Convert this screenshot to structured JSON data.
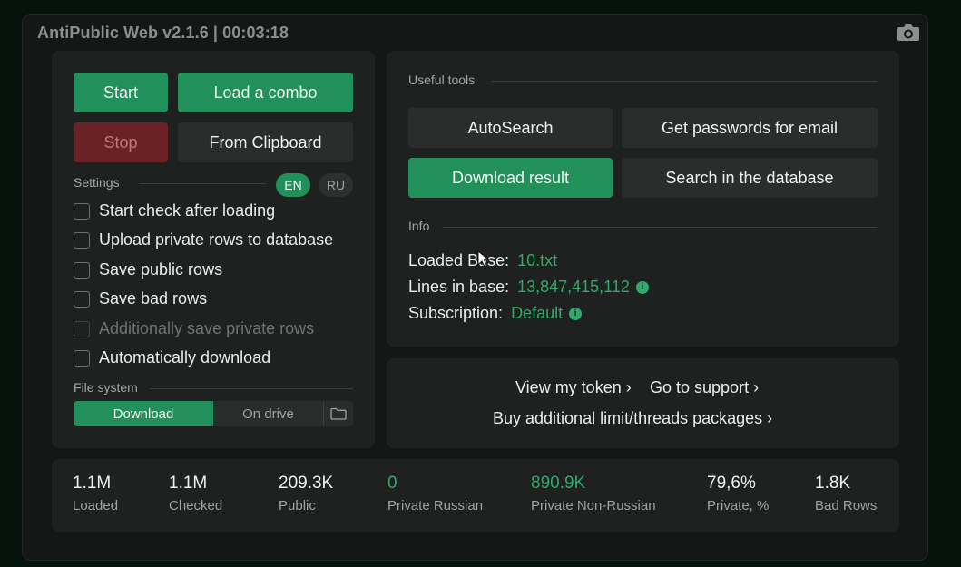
{
  "window": {
    "title": "AntiPublic Web v2.1.6 | 00:03:18",
    "icons": {
      "screenshot": "camera-icon"
    }
  },
  "controls": {
    "start": "Start",
    "load_combo": "Load a combo",
    "stop": "Stop",
    "from_clipboard": "From Clipboard"
  },
  "settings": {
    "label": "Settings",
    "languages": [
      {
        "label": "EN",
        "selected": true
      },
      {
        "label": "RU",
        "selected": false
      }
    ],
    "options": [
      {
        "label": "Start check after loading",
        "checked": false,
        "disabled": false
      },
      {
        "label": "Upload private rows to database",
        "checked": false,
        "disabled": false
      },
      {
        "label": "Save public rows",
        "checked": false,
        "disabled": false
      },
      {
        "label": "Save bad rows",
        "checked": false,
        "disabled": false
      },
      {
        "label": "Additionally save private rows",
        "checked": false,
        "disabled": true
      },
      {
        "label": "Automatically download",
        "checked": false,
        "disabled": false
      }
    ]
  },
  "file_system": {
    "label": "File system",
    "options": [
      "Download",
      "On drive"
    ],
    "selected": "Download",
    "folder_icon": "folder-icon"
  },
  "tools": {
    "label": "Useful tools",
    "buttons": {
      "autosearch": "AutoSearch",
      "get_passwords": "Get passwords for email",
      "download_result": "Download result",
      "search_database": "Search in the database"
    }
  },
  "info": {
    "label": "Info",
    "loaded_base": {
      "key": "Loaded Base:",
      "value": "10.txt"
    },
    "lines_in_base": {
      "key": "Lines in base:",
      "value": "13,847,415,112"
    },
    "subscription": {
      "key": "Subscription:",
      "value": "Default"
    },
    "icon": "info-icon"
  },
  "links": {
    "view_token": "View my token ›",
    "support": "Go to support ›",
    "buy_packages": "Buy additional limit/threads packages ›"
  },
  "stats": [
    {
      "value": "1.1M",
      "label": "Loaded",
      "accent": false
    },
    {
      "value": "1.1M",
      "label": "Checked",
      "accent": false
    },
    {
      "value": "209.3K",
      "label": "Public",
      "accent": false
    },
    {
      "value": "0",
      "label": "Private Russian",
      "accent": true
    },
    {
      "value": "890.9K",
      "label": "Private Non-Russian",
      "accent": true
    },
    {
      "value": "79,6%",
      "label": "Private, %",
      "accent": false
    },
    {
      "value": "1.8K",
      "label": "Bad Rows",
      "accent": false
    }
  ],
  "colors": {
    "accent": "#21905a",
    "accent_text": "#2eaa6a",
    "stop": "#6b2224",
    "background": "#06130d",
    "panel": "#1e2120"
  }
}
